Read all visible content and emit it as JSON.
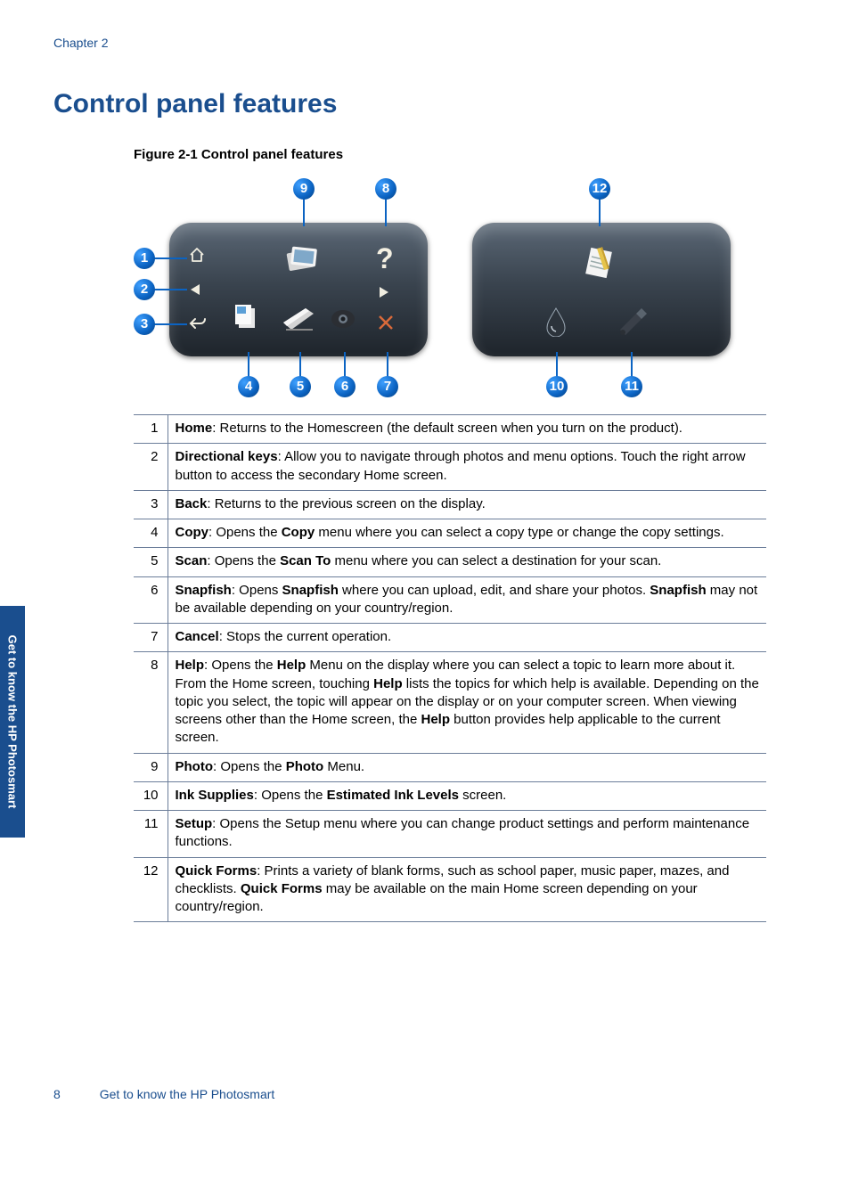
{
  "chapter_label": "Chapter 2",
  "heading": "Control panel features",
  "figure_caption": "Figure 2-1 Control panel features",
  "callouts": [
    "1",
    "2",
    "3",
    "4",
    "5",
    "6",
    "7",
    "8",
    "9",
    "10",
    "11",
    "12"
  ],
  "side_tab": "Get to know the HP Photosmart",
  "page_number": "8",
  "footer_title": "Get to know the HP Photosmart",
  "features": [
    {
      "num": "1",
      "term": "Home",
      "desc": ": Returns to the Homescreen (the default screen when you turn on the product)."
    },
    {
      "num": "2",
      "term": "Directional keys",
      "desc": ": Allow you to navigate through photos and menu options. Touch the right arrow button to access the secondary Home screen."
    },
    {
      "num": "3",
      "term": "Back",
      "desc": ": Returns to the previous screen on the display."
    },
    {
      "num": "4",
      "term": "Copy",
      "desc": ": Opens the ",
      "bold2": "Copy",
      "desc2": " menu where you can select a copy type or change the copy settings."
    },
    {
      "num": "5",
      "term": "Scan",
      "desc": ": Opens the ",
      "bold2": "Scan To",
      "desc2": " menu where you can select a destination for your scan."
    },
    {
      "num": "6",
      "term": "Snapfish",
      "desc": ": Opens ",
      "bold2": "Snapfish",
      "desc2": " where you can upload, edit, and share your photos. ",
      "bold3": "Snapfish",
      "desc3": " may not be available depending on your country/region."
    },
    {
      "num": "7",
      "term": "Cancel",
      "desc": ": Stops the current operation."
    },
    {
      "num": "8",
      "term": "Help",
      "desc": ": Opens the ",
      "bold2": "Help",
      "desc2": " Menu on the display where you can select a topic to learn more about it. From the Home screen, touching ",
      "bold3": "Help",
      "desc3": " lists the topics for which help is available. Depending on the topic you select, the topic will appear on the display or on your computer screen. When viewing screens other than the Home screen, the ",
      "bold4": "Help",
      "desc4": " button provides help applicable to the current screen."
    },
    {
      "num": "9",
      "term": "Photo",
      "desc": ": Opens the ",
      "bold2": "Photo",
      "desc2": " Menu."
    },
    {
      "num": "10",
      "term": "Ink Supplies",
      "desc": ": Opens the ",
      "bold2": "Estimated Ink Levels",
      "desc2": " screen."
    },
    {
      "num": "11",
      "term": "Setup",
      "desc": ": Opens the Setup menu where you can change product settings and perform maintenance functions."
    },
    {
      "num": "12",
      "term": "Quick Forms",
      "desc": ": Prints a variety of blank forms, such as school paper, music paper, mazes, and checklists. ",
      "bold2": "Quick Forms",
      "desc2": " may be available on the main Home screen depending on your country/region."
    }
  ]
}
